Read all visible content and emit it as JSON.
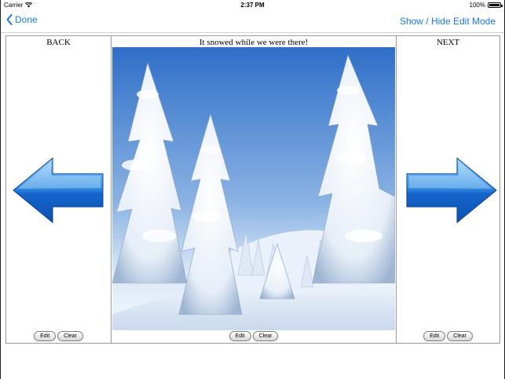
{
  "status_bar": {
    "carrier": "Carrier",
    "time": "2:37 PM",
    "battery_percent": "100%",
    "battery_level": 1.0
  },
  "nav": {
    "back_label": "Done",
    "right_action": "Show / Hide Edit Mode"
  },
  "panels": {
    "left": {
      "title": "BACK",
      "edit_label": "Edit",
      "clear_label": "Clear"
    },
    "center": {
      "title": "It snowed while we were there!",
      "edit_label": "Edit",
      "clear_label": "Clear"
    },
    "right": {
      "title": "NEXT",
      "edit_label": "Edit",
      "clear_label": "Clear"
    }
  },
  "colors": {
    "accent": "#1a7ae0",
    "arrow_light": "#8fd0ff",
    "arrow_dark": "#0b4fb0",
    "sky_top": "#2f6fc8",
    "sky_bottom": "#dbe8f6"
  }
}
